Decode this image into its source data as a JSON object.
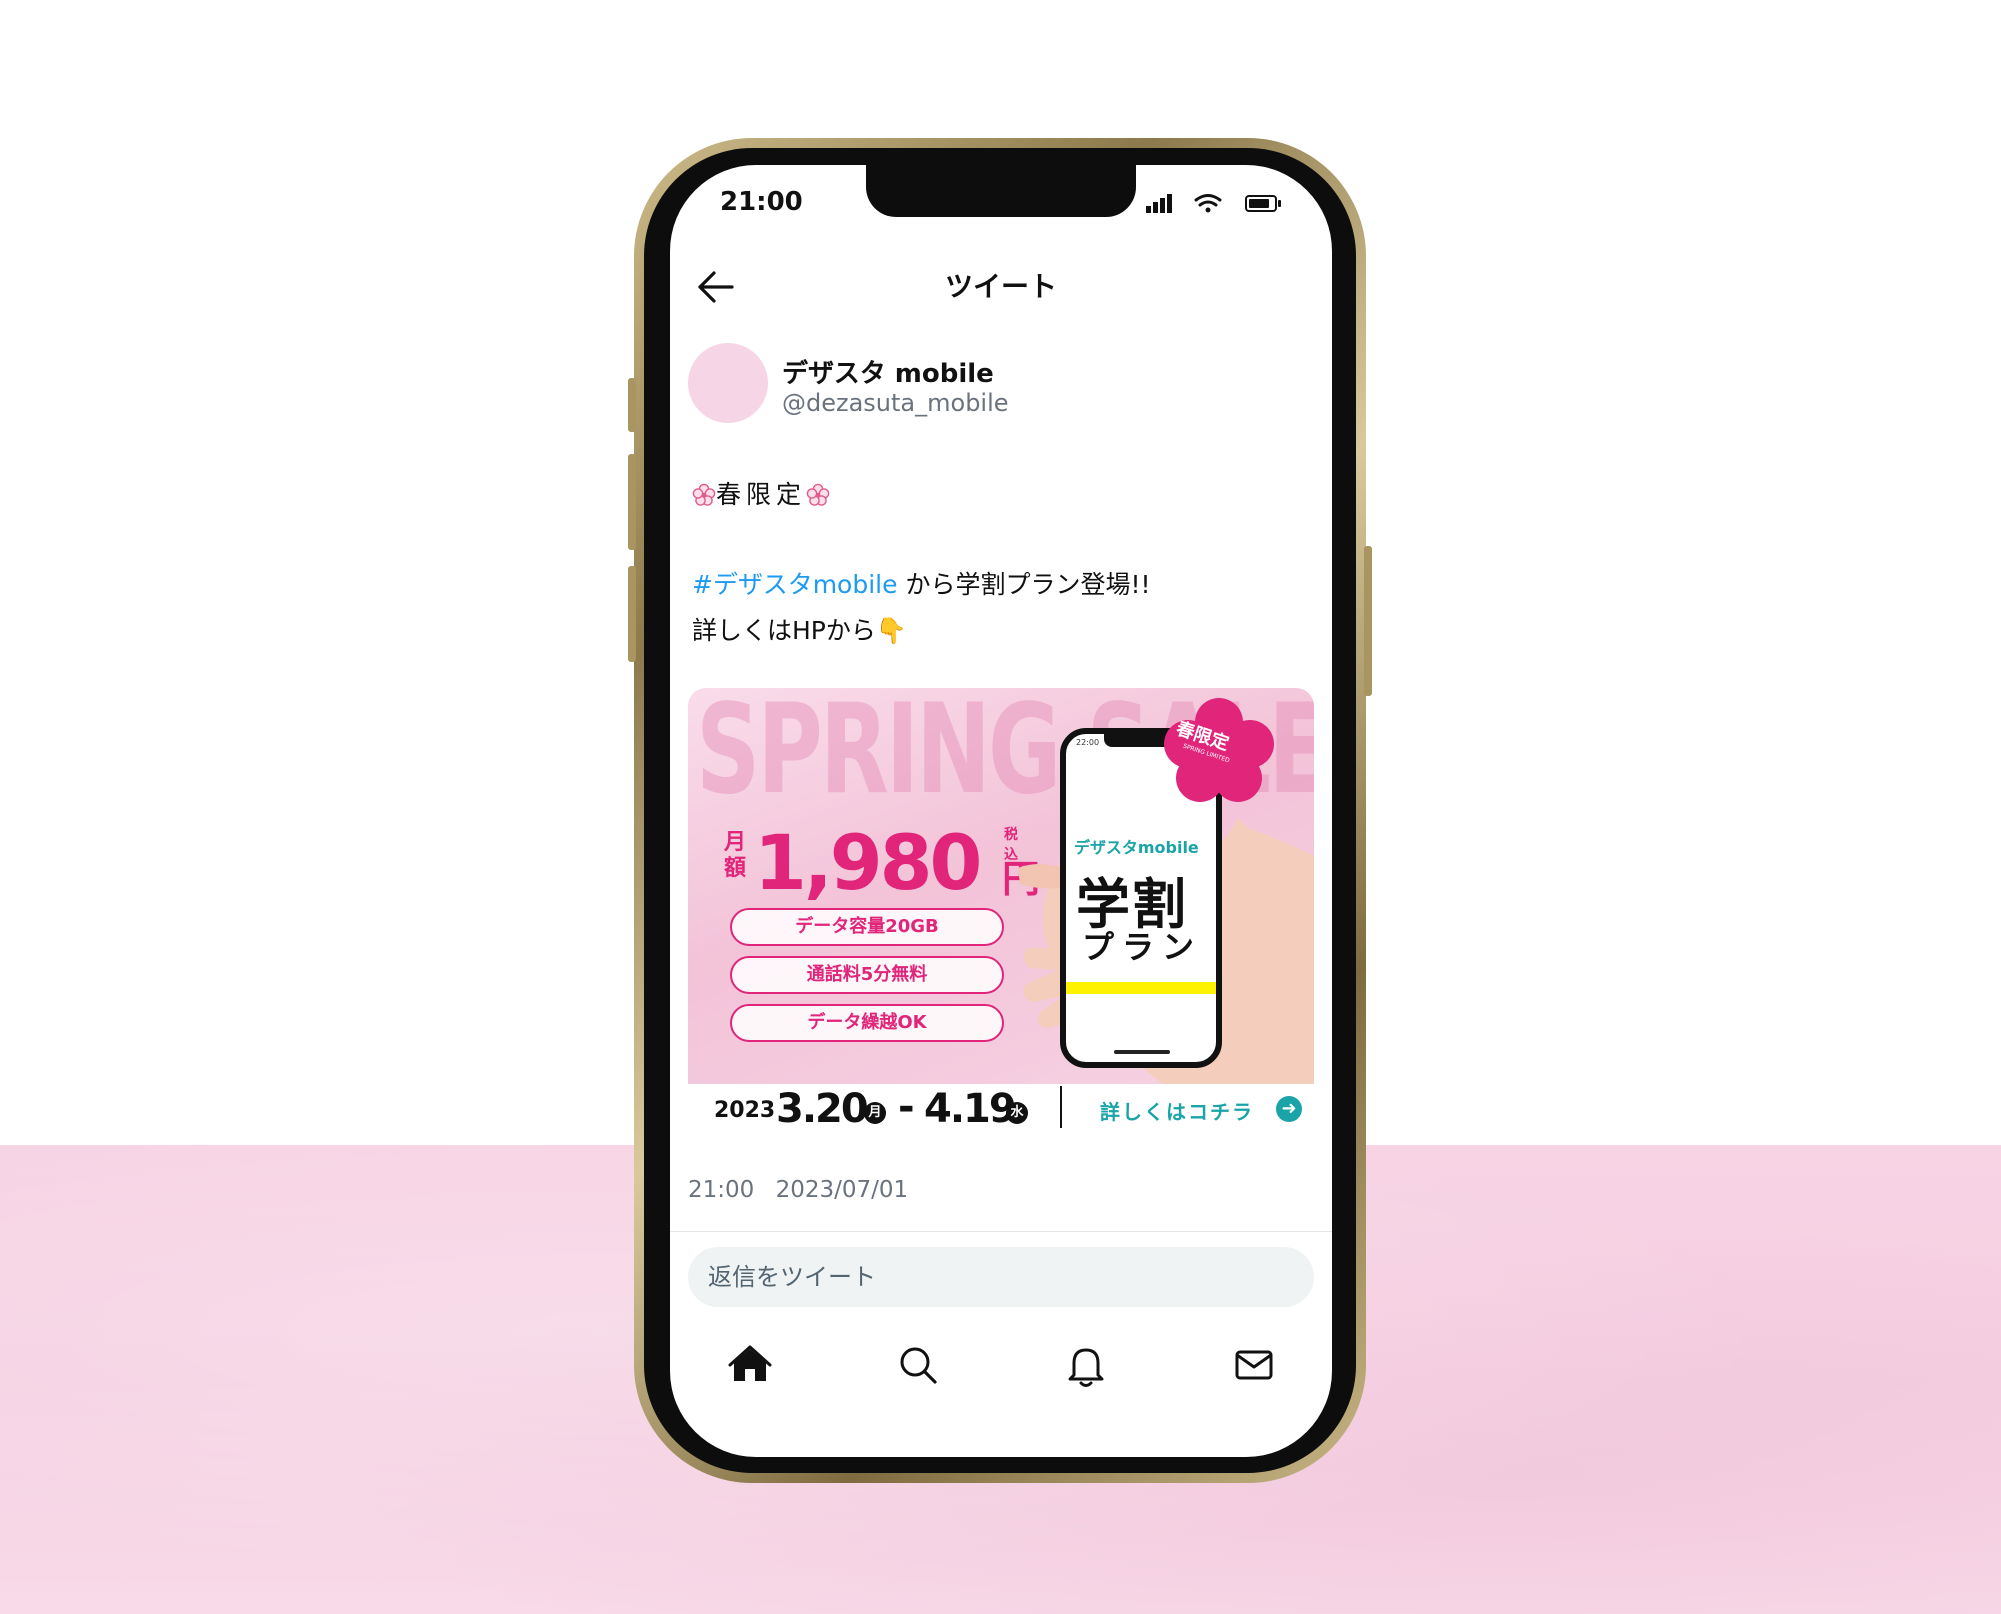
{
  "status_bar": {
    "time": "21:00"
  },
  "nav": {
    "title": "ツイート"
  },
  "author": {
    "display_name": "デザスタ mobile",
    "handle": "@dezasuta_mobile"
  },
  "tweet": {
    "headline": "春限定",
    "hashtag": "#デザスタmobile",
    "line2_rest": " から学割プラン登場!!",
    "line3": "詳しくはHPから",
    "pointing_emoji": "👇"
  },
  "banner": {
    "background_text": "SPRING SALE",
    "price_prefix": "月額",
    "price": "1,980",
    "tax_label": "税込",
    "currency": "円",
    "features": [
      "データ容量20GB",
      "通話料5分無料",
      "データ繰越OK"
    ],
    "badge_text": "春限定",
    "badge_sub": "SPRING LIMITED",
    "phone_time": "22:00",
    "phone_brand": "デザスタmobile",
    "phone_title": "学割",
    "phone_subtitle": "プラン",
    "date_year": "2023",
    "date_start": "3.20",
    "date_start_dow": "月",
    "date_separator": "-",
    "date_end": "4.19",
    "date_end_dow": "水",
    "detail_link": "詳しくはコチラ"
  },
  "timestamp": "21:00 2023/07/01",
  "reply": {
    "placeholder": "返信をツイート"
  },
  "tabbar": [
    "home-icon",
    "search-icon",
    "bell-icon",
    "mail-icon"
  ],
  "colors": {
    "hashtag": "#1d9bf0",
    "brand_pink": "#e0257a",
    "brand_teal": "#1aa4a8",
    "avatar": "#f6d5e6"
  }
}
